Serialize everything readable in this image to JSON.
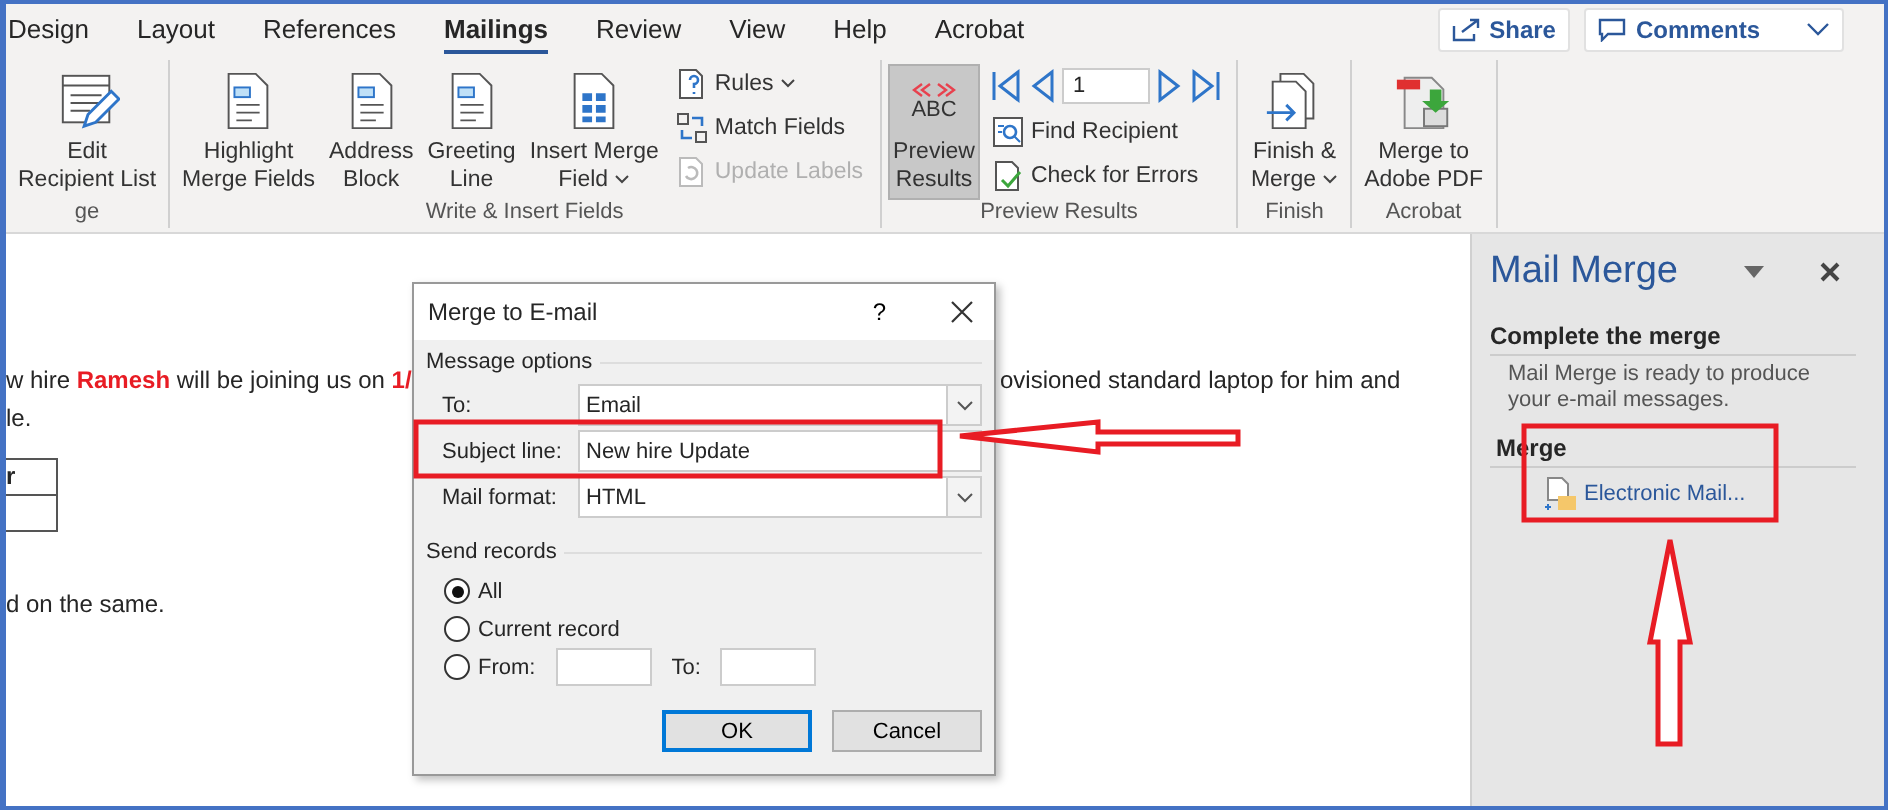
{
  "tabs": [
    {
      "label": "Design",
      "selected": false
    },
    {
      "label": "Layout",
      "selected": false
    },
    {
      "label": "References",
      "selected": false
    },
    {
      "label": "Mailings",
      "selected": true
    },
    {
      "label": "Review",
      "selected": false
    },
    {
      "label": "View",
      "selected": false
    },
    {
      "label": "Help",
      "selected": false
    },
    {
      "label": "Acrobat",
      "selected": false
    }
  ],
  "header_buttons": [
    {
      "label": "Share",
      "kind": "share"
    },
    {
      "label": "Comments",
      "kind": "comments"
    }
  ],
  "ribbon_groups": [
    {
      "label": "ge",
      "items": [
        {
          "kind": "large",
          "lines": [
            "Edit",
            "Recipient List"
          ],
          "dropdown": false,
          "selected": false
        }
      ]
    },
    {
      "label": "Write & Insert Fields",
      "items": [
        {
          "kind": "large",
          "lines": [
            "Highlight",
            "Merge Fields"
          ],
          "dropdown": false,
          "selected": false
        },
        {
          "kind": "large",
          "lines": [
            "Address",
            "Block"
          ],
          "dropdown": false,
          "selected": false
        },
        {
          "kind": "large",
          "lines": [
            "Greeting",
            "Line"
          ],
          "dropdown": false,
          "selected": false
        },
        {
          "kind": "large",
          "lines": [
            "Insert Merge",
            "Field"
          ],
          "dropdown": true,
          "selected": false
        },
        {
          "kind": "stack",
          "entries": [
            {
              "label": "Rules",
              "dropdown": true,
              "disabled": false
            },
            {
              "label": "Match Fields",
              "dropdown": false,
              "disabled": false
            },
            {
              "label": "Update Labels",
              "dropdown": false,
              "disabled": true
            }
          ]
        }
      ]
    },
    {
      "label": "Preview Results",
      "items": [
        {
          "kind": "large",
          "icon_text": "ABC",
          "lines": [
            "Preview",
            "Results"
          ],
          "dropdown": false,
          "selected": true
        },
        {
          "kind": "nav",
          "record": "1",
          "entries": [
            {
              "label": "Find Recipient",
              "disabled": false
            },
            {
              "label": "Check for Errors",
              "disabled": false
            }
          ]
        }
      ]
    },
    {
      "label": "Finish",
      "items": [
        {
          "kind": "large",
          "lines": [
            "Finish &",
            "Merge"
          ],
          "dropdown": true,
          "selected": false
        }
      ]
    },
    {
      "label": "Acrobat",
      "items": [
        {
          "kind": "large",
          "lines": [
            "Merge to",
            "Adobe PDF"
          ],
          "dropdown": false,
          "selected": false
        }
      ]
    }
  ],
  "document": {
    "line_1_left": "w hire **Ramesh** will be joining us on **1/**",
    "line_1_right": "ovisioned standard laptop for him and",
    "line_2": "le.",
    "table_cells": [
      "r",
      ""
    ],
    "line_3": "d on the same."
  },
  "dialog": {
    "title": "Merge to E-mail",
    "help": "?",
    "message_options": "Message options",
    "fields": [
      {
        "label": "To:",
        "value": "Email",
        "kind": "dropdown"
      },
      {
        "label": "Subject line:",
        "value": "New hire Update",
        "kind": "text"
      },
      {
        "label": "Mail format:",
        "value": "HTML",
        "kind": "dropdown"
      }
    ],
    "send_records": "Send records",
    "records": [
      {
        "label": "All",
        "selected": true,
        "kind": "plain"
      },
      {
        "label": "Current record",
        "selected": false,
        "kind": "plain"
      },
      {
        "label": "From:",
        "selected": false,
        "kind": "range",
        "to_label": "To:"
      }
    ],
    "buttons": [
      {
        "label": "OK",
        "default": true
      },
      {
        "label": "Cancel",
        "default": false
      }
    ]
  },
  "pane": {
    "title": "Mail Merge",
    "section_1": "Complete the merge",
    "description": "Mail Merge is ready to produce your e-mail messages.",
    "section_2": "Merge",
    "link": "Electronic Mail..."
  }
}
